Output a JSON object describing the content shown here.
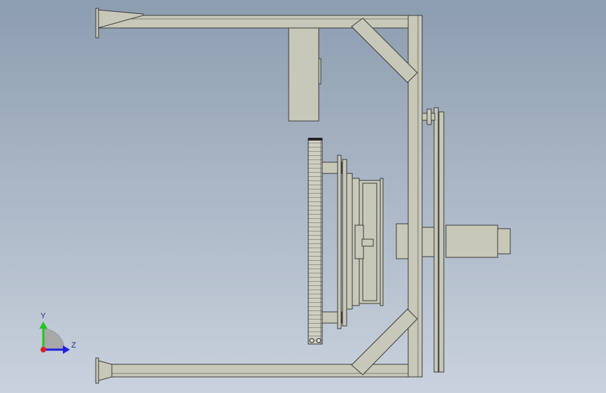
{
  "triad": {
    "y_label": "Y",
    "z_label": "Z"
  },
  "colors": {
    "frame_fill": "#c8c8b8",
    "frame_stroke": "#3a3a3a",
    "background_top": "#8d9db0",
    "background_bottom": "#c9d2dd",
    "axis_y": "#1ec81e",
    "axis_z": "#2020e0",
    "axis_x": "#e02020"
  }
}
